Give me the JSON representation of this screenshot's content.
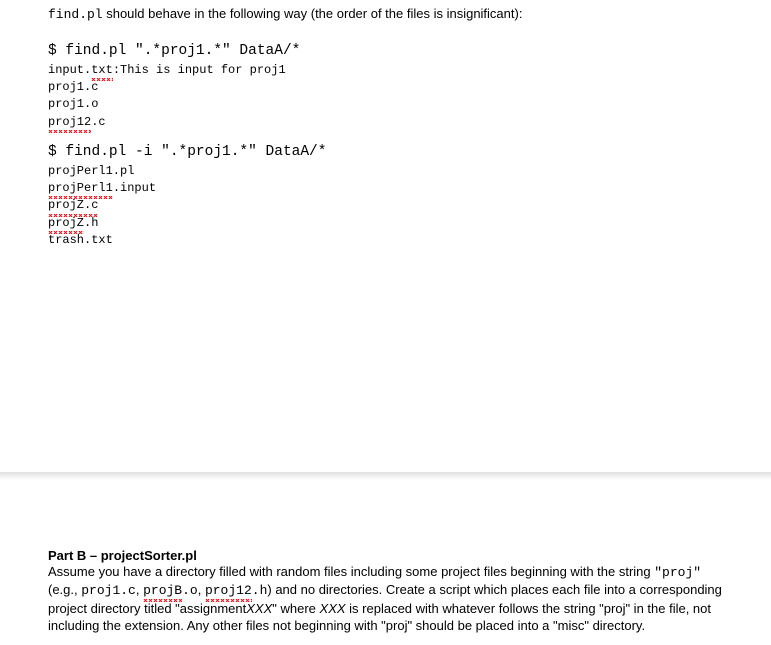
{
  "intro_code": "find.pl",
  "intro_rest": " should behave in the following way (the order of the files is insignificant):",
  "ex1": {
    "cmd": "$ find.pl \".*proj1.*\" DataA/*",
    "lines": [
      {
        "pre": "input.",
        "sq": "txt",
        "post": ":This is input for proj1"
      },
      {
        "pre": "proj1.c",
        "sq": "",
        "post": ""
      },
      {
        "pre": "proj1.o",
        "sq": "",
        "post": ""
      },
      {
        "pre": "",
        "sq": "proj12",
        "post": ".c"
      }
    ]
  },
  "ex2": {
    "cmd": "$ find.pl -i \".*proj1.*\" DataA/*",
    "lines": [
      {
        "pre": "projPerl1.pl",
        "sq": "",
        "post": ""
      },
      {
        "pre": "",
        "sq": "projPerl1",
        "post": ".input"
      },
      {
        "pre": "",
        "sq": "projZ.c",
        "post": ""
      },
      {
        "pre": "",
        "sq": "projZ",
        "post": ".h"
      },
      {
        "pre": "trash.txt",
        "sq": "",
        "post": ""
      }
    ]
  },
  "partB": {
    "title": "Part B – projectSorter.pl",
    "t1": "Assume you have a directory filled with random files including some project files beginning with the string ",
    "t2": "\"proj\"",
    "t3": " (e.g., ",
    "e1": "proj1.c",
    "t4": ", ",
    "e2_sq": "projB",
    "e2_post": ".o",
    "t5": ", ",
    "e3_sq": "proj12",
    "e3_post": ".h",
    "t6": ") and no directories. Create a script which places each file into a corresponding project directory titled \"assignment",
    "t7_italic": "XXX",
    "t8": "\" where ",
    "t9_italic": "XXX",
    "t10": " is replaced with whatever follows the string \"proj\" in the file, not including the extension. Any other files not beginning with \"proj\" should be placed into a \"misc\" directory."
  }
}
